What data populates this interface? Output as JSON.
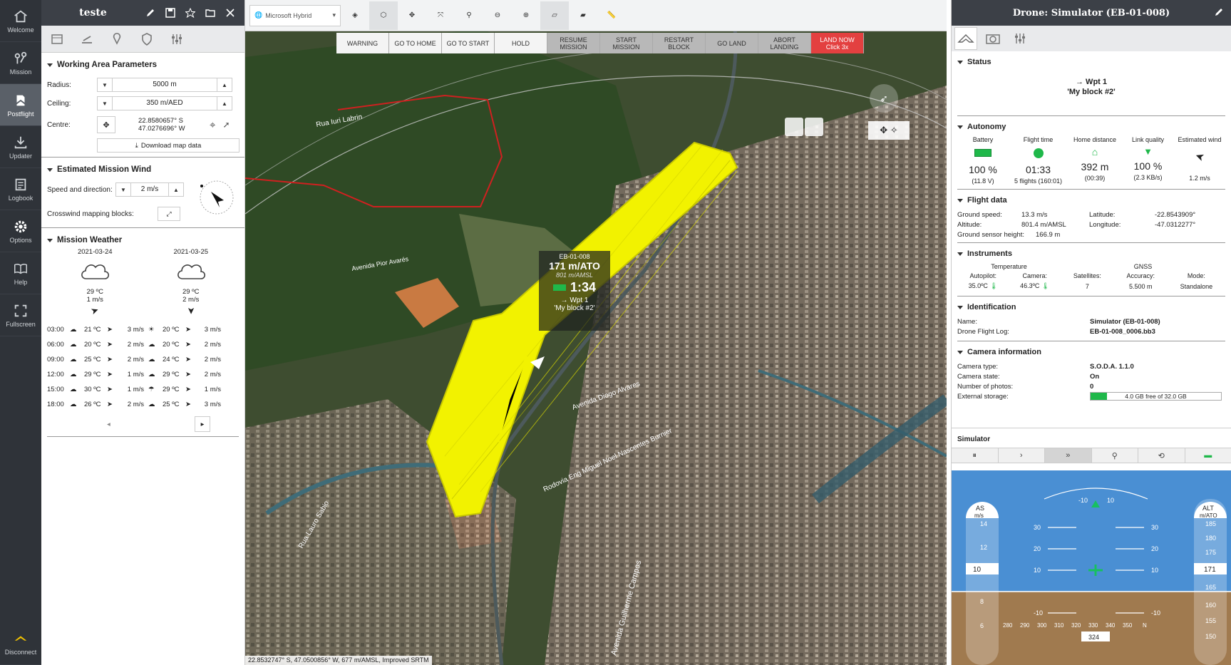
{
  "nav": {
    "items": [
      {
        "label": "Welcome",
        "icon": "home-icon"
      },
      {
        "label": "Mission",
        "icon": "waypoints-icon"
      },
      {
        "label": "Postflight",
        "icon": "postflight-icon"
      },
      {
        "label": "Updater",
        "icon": "download-icon"
      },
      {
        "label": "Logbook",
        "icon": "logbook-icon"
      },
      {
        "label": "Options",
        "icon": "gear-icon"
      },
      {
        "label": "Help",
        "icon": "book-icon"
      },
      {
        "label": "Fullscreen",
        "icon": "fullscreen-icon"
      }
    ],
    "active": "Postflight",
    "disconnect": "Disconnect"
  },
  "left_panel": {
    "title": "teste",
    "working_area": {
      "header": "Working Area Parameters",
      "radius_label": "Radius:",
      "radius_value": "5000 m",
      "ceiling_label": "Ceiling:",
      "ceiling_value": "350 m/AED",
      "centre_label": "Centre:",
      "centre_lat": "22.8580657° S",
      "centre_lon": "47.0276696° W",
      "download_label": "Download map data"
    },
    "wind": {
      "header": "Estimated Mission Wind",
      "speed_label": "Speed and direction:",
      "speed_value": "2 m/s",
      "crosswind_label": "Crosswind mapping blocks:"
    },
    "weather": {
      "header": "Mission Weather",
      "days": [
        {
          "date": "2021-03-24",
          "temp": "29 ºC",
          "wind": "1 m/s"
        },
        {
          "date": "2021-03-25",
          "temp": "29 ºC",
          "wind": "2 m/s"
        }
      ],
      "rows": [
        {
          "time": "03:00",
          "t1": "21 ºC",
          "w1": "3 m/s",
          "t2": "20 ºC",
          "w2": "3 m/s"
        },
        {
          "time": "06:00",
          "t1": "20 ºC",
          "w1": "2 m/s",
          "t2": "20 ºC",
          "w2": "2 m/s"
        },
        {
          "time": "09:00",
          "t1": "25 ºC",
          "w1": "2 m/s",
          "t2": "24 ºC",
          "w2": "2 m/s"
        },
        {
          "time": "12:00",
          "t1": "29 ºC",
          "w1": "1 m/s",
          "t2": "29 ºC",
          "w2": "2 m/s"
        },
        {
          "time": "15:00",
          "t1": "30 ºC",
          "w1": "1 m/s",
          "t2": "29 ºC",
          "w2": "1 m/s"
        },
        {
          "time": "18:00",
          "t1": "26 ºC",
          "w1": "2 m/s",
          "t2": "25 ºC",
          "w2": "3 m/s"
        }
      ]
    }
  },
  "map": {
    "layer": "Microsoft Hybrid",
    "commands": [
      {
        "label": "WARNING",
        "style": "lt"
      },
      {
        "label": "GO TO HOME",
        "style": "lt"
      },
      {
        "label": "GO TO START",
        "style": "lt"
      },
      {
        "label": "HOLD",
        "style": "lt"
      },
      {
        "label": "RESUME MISSION",
        "style": "dk"
      },
      {
        "label": "START MISSION",
        "style": "dk"
      },
      {
        "label": "RESTART BLOCK",
        "style": "dk"
      },
      {
        "label": "GO LAND",
        "style": "dk"
      },
      {
        "label": "ABORT LANDING",
        "style": "dk"
      },
      {
        "label": "LAND NOW Click 3x",
        "style": "red"
      }
    ],
    "drone_label": {
      "id": "EB-01-008",
      "alt": "171 m/ATO",
      "amsl": "801 m/AMSL",
      "time": "1:34",
      "wpt": "→ Wpt 1",
      "block": "'My block #2'"
    },
    "street_labels": [
      "Rua Iuri Labrin",
      "Avenida Pior Avarés",
      "Rua Guilherme Campos",
      "Rodovia Eng Miguel Noel Nascentes Burnier",
      "Avenida Diogo Alvares",
      "Avenida Guilherme Campos",
      "Rua Lauro Sabio",
      "Rua Moscou"
    ],
    "coordinates": "22.8532747° S, 47.0500856° W, 677 m/AMSL, Improved SRTM"
  },
  "right_panel": {
    "title": "Drone: Simulator (EB-01-008)",
    "status": {
      "header": "Status",
      "line1": "→ Wpt 1",
      "line2": "'My block #2'"
    },
    "autonomy": {
      "header": "Autonomy",
      "cols": [
        {
          "label": "Battery",
          "value": "100 %",
          "sub": "(11.8 V)",
          "icon": "battery-icon"
        },
        {
          "label": "Flight time",
          "value": "01:33",
          "sub": "5 flights (160:01)",
          "icon": "clock-icon"
        },
        {
          "label": "Home distance",
          "value": "392 m",
          "sub": "(00:39)",
          "icon": "home-icon"
        },
        {
          "label": "Link quality",
          "value": "100 %",
          "sub": "(2.3 KB/s)",
          "icon": "signal-icon"
        },
        {
          "label": "Estimated wind",
          "value": "",
          "sub": "1.2 m/s",
          "icon": "wind-arrow-icon"
        }
      ]
    },
    "flight_data": {
      "header": "Flight data",
      "ground_speed_label": "Ground speed:",
      "ground_speed": "13.3 m/s",
      "altitude_label": "Altitude:",
      "altitude": "801.4 m/AMSL",
      "ground_sensor_label": "Ground sensor height:",
      "ground_sensor": "166.9 m",
      "latitude_label": "Latitude:",
      "latitude": "-22.8543909°",
      "longitude_label": "Longitude:",
      "longitude": "-47.0312277°"
    },
    "instruments": {
      "header": "Instruments",
      "temperature_label": "Temperature",
      "autopilot_label": "Autopilot:",
      "autopilot": "35.0ºC",
      "camera_label": "Camera:",
      "camera": "46.3ºC",
      "gnss_label": "GNSS",
      "satellites_label": "Satellites:",
      "satellites": "7",
      "accuracy_label": "Accuracy:",
      "accuracy": "5.500 m",
      "mode_label": "Mode:",
      "mode": "Standalone"
    },
    "identification": {
      "header": "Identification",
      "name_label": "Name:",
      "name": "Simulator (EB-01-008)",
      "log_label": "Drone Flight Log:",
      "log": "EB-01-008_0006.bb3"
    },
    "camera_info": {
      "header": "Camera information",
      "type_label": "Camera type:",
      "type": "S.O.D.A. 1.1.0",
      "state_label": "Camera state:",
      "state": "On",
      "photos_label": "Number of photos:",
      "photos": "0",
      "storage_label": "External storage:",
      "storage": "4.0 GB free of 32.0 GB",
      "storage_free_fraction": 0.125
    },
    "simulator": {
      "header": "Simulator"
    },
    "pfd": {
      "as_label": "AS",
      "as_unit": "m/s",
      "as_value": "10",
      "as_ticks": [
        "14",
        "12",
        "10",
        "8",
        "6"
      ],
      "alt_label": "ALT",
      "alt_unit": "m/ATO",
      "alt_value": "171",
      "alt_ticks": [
        "185",
        "180",
        "175",
        "171",
        "165",
        "160",
        "155",
        "150"
      ],
      "pitch_ticks": [
        "30",
        "20",
        "10",
        "-10"
      ],
      "roll_labels": [
        "-10",
        "10"
      ],
      "heading_ticks": [
        "280",
        "290",
        "300",
        "310",
        "320",
        "330",
        "340",
        "350",
        "N"
      ],
      "heading_value": "324"
    }
  }
}
